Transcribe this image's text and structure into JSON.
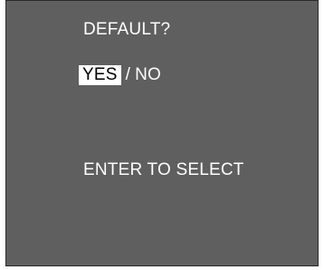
{
  "dialog": {
    "title": "DEFAULT?",
    "options": [
      {
        "label": "YES",
        "selected": true
      },
      {
        "label": "NO",
        "selected": false
      }
    ],
    "separator": "/",
    "hint": "ENTER TO SELECT"
  },
  "colors": {
    "screen_background": "#5f5f5f",
    "text": "#ffffff",
    "selection_background": "#ffffff",
    "selection_text": "#000000"
  }
}
